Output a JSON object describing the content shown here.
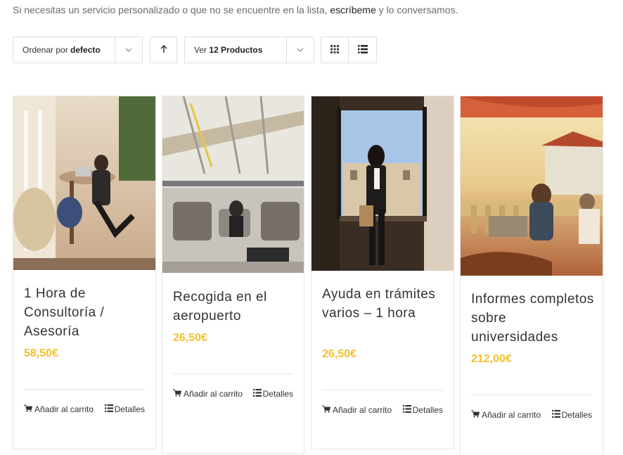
{
  "intro": {
    "text_before": "Si necesitas un servicio personalizado o que no se encuentre en la lista,",
    "link": "escríbeme",
    "text_after": "y lo conversamos."
  },
  "toolbar": {
    "sort_prefix": "Ordenar por",
    "sort_value": "defecto",
    "view_prefix": "Ver",
    "view_value": "12 Productos"
  },
  "products": [
    {
      "title": "1 Hora de Consultoría / Asesoría",
      "price": "58,50€",
      "add_label": "Añadir al carrito",
      "details_label": "Detalles"
    },
    {
      "title": "Recogida en el aeropuerto",
      "price": "26,50€",
      "add_label": "Añadir al carrito",
      "details_label": "Detalles"
    },
    {
      "title": "Ayuda en trámites varios – 1 hora",
      "price": "26,50€",
      "add_label": "Añadir al carrito",
      "details_label": "Detalles"
    },
    {
      "title": "Informes completos sobre universidades",
      "price": "212,00€",
      "add_label": "Añadir al carrito",
      "details_label": "Detalles"
    }
  ],
  "colors": {
    "price": "#f2c12e",
    "border": "#e6e6e6",
    "text": "#333333"
  },
  "icons": [
    "chevron-down-icon",
    "sort-arrow-up-icon",
    "grid-view-icon",
    "list-view-icon",
    "cart-icon",
    "list-icon"
  ]
}
